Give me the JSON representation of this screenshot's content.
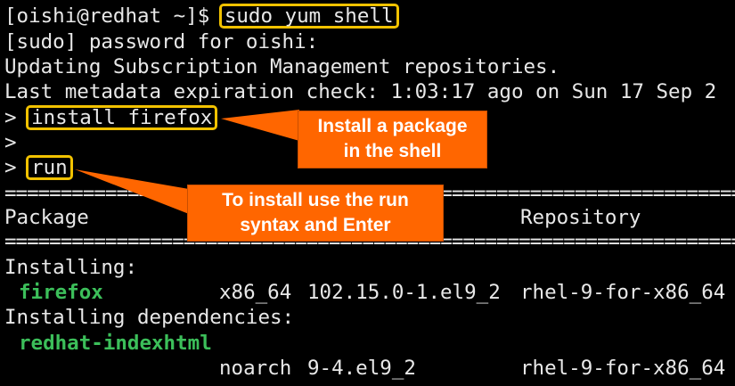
{
  "terminal": {
    "prompt": "[oishi@redhat ~]$ ",
    "command": "sudo yum shell",
    "sudo_prompt": "[sudo] password for oishi:",
    "updating": "Updating Subscription Management repositories.",
    "metadata": "Last metadata expiration check: 1:03:17 ago on Sun 17 Sep 2",
    "shell_prompt": "> ",
    "cmd_install": "install firefox",
    "cmd_run": "run",
    "header_package": "Package",
    "header_repository": "Repository",
    "installing_label": "Installing:",
    "pkg1_name": "firefox",
    "pkg1_arch": "x86_64",
    "pkg1_version": "102.15.0-1.el9_2",
    "pkg1_repo": "rhel-9-for-x86_64",
    "deps_label": "Installing dependencies:",
    "pkg2_name": "redhat-indexhtml",
    "pkg2_arch": "noarch",
    "pkg2_version": "9-4.el9_2",
    "pkg2_repo": "rhel-9-for-x86_64"
  },
  "annotations": {
    "callout1_line1": "Install a package",
    "callout1_line2": "in the shell",
    "callout2_line1": "To install use the run",
    "callout2_line2": "syntax and Enter"
  },
  "colors": {
    "highlight_border": "#f2c200",
    "callout_bg": "#ff6600",
    "package_name": "#3cbf5a"
  }
}
